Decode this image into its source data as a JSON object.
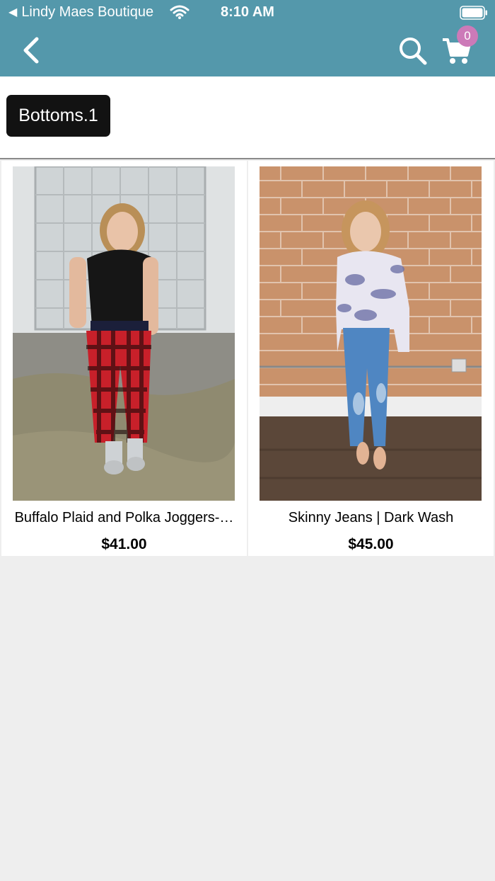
{
  "status_bar": {
    "back_app_label": "Lindy Maes Boutique",
    "time": "8:10 AM",
    "icons": [
      "wifi-icon",
      "battery-icon"
    ]
  },
  "header": {
    "back_icon": "chevron-left-icon",
    "search_icon": "search-icon",
    "cart_icon": "cart-icon",
    "cart_count": "0",
    "bar_color": "#5498ab",
    "badge_color": "#cc7ab8"
  },
  "category": {
    "label": "Bottoms.1"
  },
  "products": [
    {
      "name": "Buffalo Plaid and Polka Joggers-…",
      "price": "$41.00",
      "image": "woman in black tee and red buffalo plaid joggers"
    },
    {
      "name": "Skinny Jeans | Dark Wash",
      "price": "$45.00",
      "image": "woman in camo hoodie and ripped skinny jeans"
    }
  ]
}
